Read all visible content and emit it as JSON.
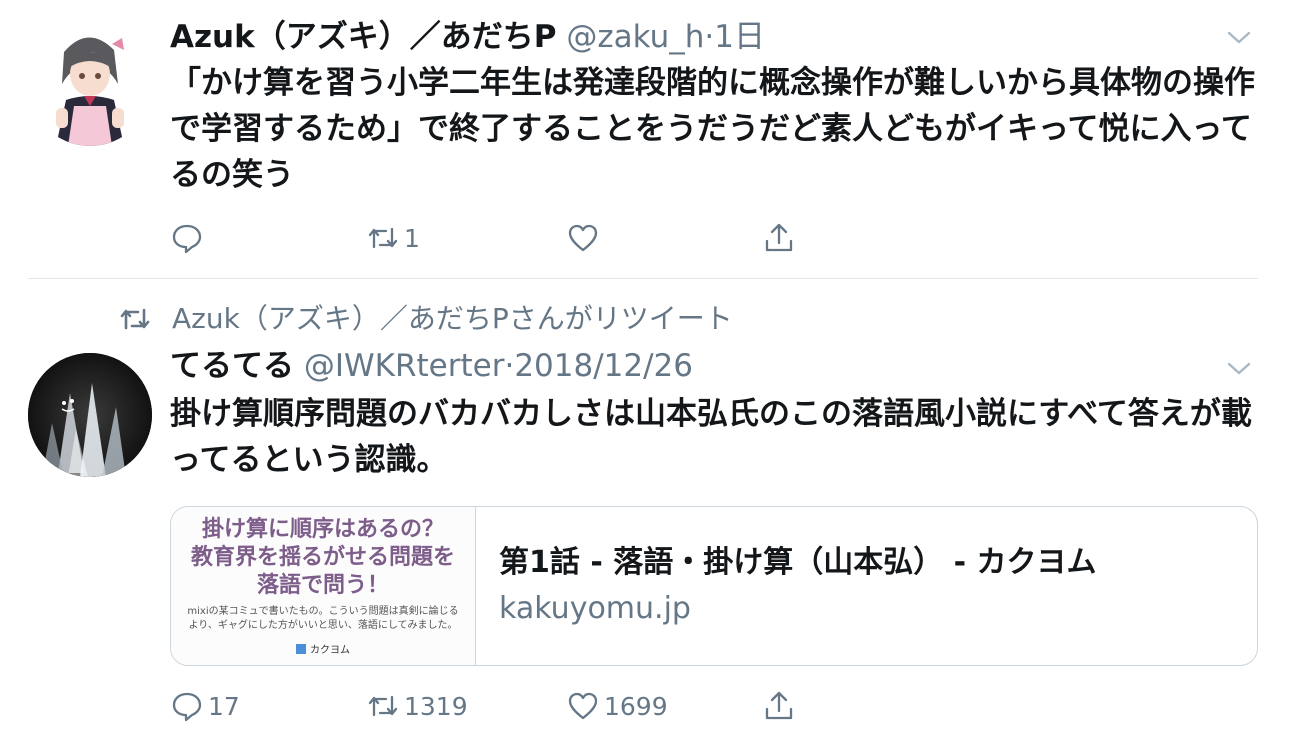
{
  "tweet1": {
    "name": "Azuk（アズキ）／あだちP",
    "handle": "@zaku_h",
    "separator": "·",
    "time": "1日",
    "text": "「かけ算を習う小学二年生は発達段階的に概念操作が難しいから具体物の操作で学習するため」で終了することをうだうだど素人どもがイキって悦に入ってるの笑う",
    "replies": "",
    "retweets": "1",
    "likes": ""
  },
  "retweet_banner": {
    "text": "Azuk（アズキ）／あだちPさんがリツイート"
  },
  "tweet2": {
    "name": "てるてる",
    "handle": "@IWKRterter",
    "separator": "·",
    "time": "2018/12/26",
    "text": "掛け算順序問題のバカバカしさは山本弘氏のこの落語風小説にすべて答えが載ってるという認識。",
    "card": {
      "thumb_title": "掛け算に順序はあるの？\n教育界を揺るがせる問題を\n落語で問う！",
      "thumb_desc": "mixiの某コミュで書いたもの。こういう問題は真剣に論じる\nより、ギャグにした方がいいと思い、落語にしてみました。",
      "thumb_brand": "カクヨム",
      "title": "第1話 - 落語・掛け算（山本弘） - カクヨム",
      "domain": "kakuyomu.jp"
    },
    "replies": "17",
    "retweets": "1319",
    "likes": "1699"
  },
  "colors": {
    "text": "#14171a",
    "secondary": "#657786",
    "border": "#ccd6dd",
    "divider": "#e1e8ed",
    "thumb_title": "#7d5d8a"
  },
  "icons": [
    "chevron-down-icon",
    "reply-icon",
    "retweet-icon",
    "like-icon",
    "share-icon"
  ]
}
